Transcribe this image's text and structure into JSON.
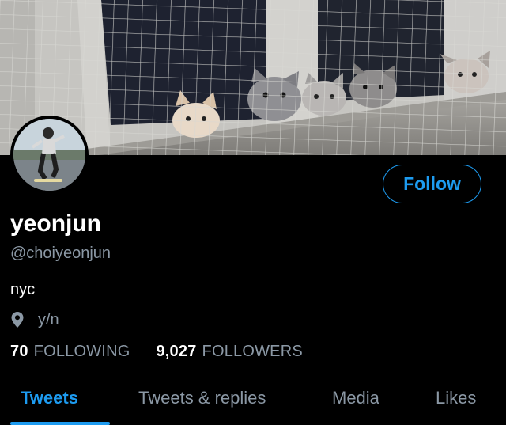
{
  "profile": {
    "display_name": "yeonjun",
    "handle": "@choiyeonjun",
    "bio": "nyc",
    "location": "y/n",
    "location_icon": "map-pin-icon",
    "banner_image": "kittens-behind-net-photo",
    "avatar_image": "skateboarder-photo"
  },
  "actions": {
    "follow_label": "Follow"
  },
  "stats": {
    "following_count": "70",
    "following_label": "FOLLOWING",
    "followers_count": "9,027",
    "followers_label": "FOLLOWERS"
  },
  "tabs": [
    {
      "label": "Tweets",
      "active": true
    },
    {
      "label": "Tweets & replies",
      "active": false
    },
    {
      "label": "Media",
      "active": false
    },
    {
      "label": "Likes",
      "active": false
    }
  ],
  "colors": {
    "accent": "#1d9bf0",
    "background": "#000000",
    "secondary_text": "#8b98a5"
  }
}
